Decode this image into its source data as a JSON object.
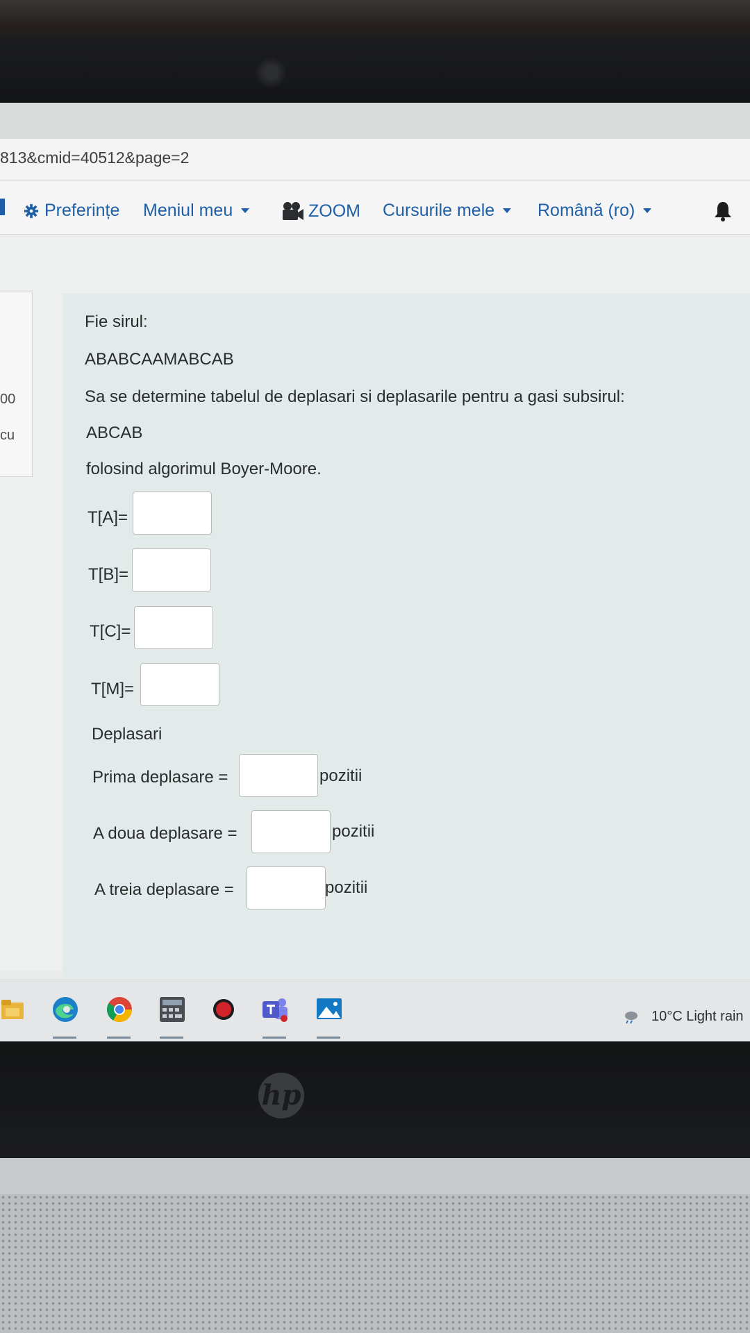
{
  "browser": {
    "url": "813&cmid=40512&page=2"
  },
  "navbar": {
    "preferences_label": "Preferințe",
    "my_menu_label": "Meniul meu",
    "zoom_label": "ZOOM",
    "my_courses_label": "Cursurile mele",
    "language_label": "Română (ro)"
  },
  "left_panel": {
    "line1": "00",
    "line2": "cu"
  },
  "question": {
    "intro": "Fie sirul:",
    "text_string": "ABABCAAMABCAB",
    "instruction": "Sa se determine tabelul de deplasari si deplasarile pentru a gasi subsirul:",
    "pattern": "ABCAB",
    "method": "folosind algorimul Boyer-Moore.",
    "table_fields": [
      {
        "label": "T[A]=",
        "value": ""
      },
      {
        "label": "T[B]=",
        "value": ""
      },
      {
        "label": "T[C]=",
        "value": ""
      },
      {
        "label": "T[M]=",
        "value": ""
      }
    ],
    "shifts_heading": "Deplasari",
    "shift_fields": [
      {
        "label": "Prima deplasare =",
        "value": "",
        "unit": "pozitii"
      },
      {
        "label": "A doua deplasare =",
        "value": "",
        "unit": "pozitii"
      },
      {
        "label": "A treia deplasare =",
        "value": "",
        "unit": "pozitii"
      }
    ]
  },
  "taskbar": {
    "icons": [
      "file-explorer-icon",
      "edge-icon",
      "chrome-icon",
      "calculator-icon",
      "record-icon",
      "teams-icon",
      "photos-icon"
    ],
    "weather": "10°C  Light rain"
  },
  "device": {
    "logo": "hp"
  },
  "colors": {
    "link": "#1f5fa8",
    "card_bg": "#e3ebea",
    "taskbar_bg": "#e4e6e8"
  }
}
